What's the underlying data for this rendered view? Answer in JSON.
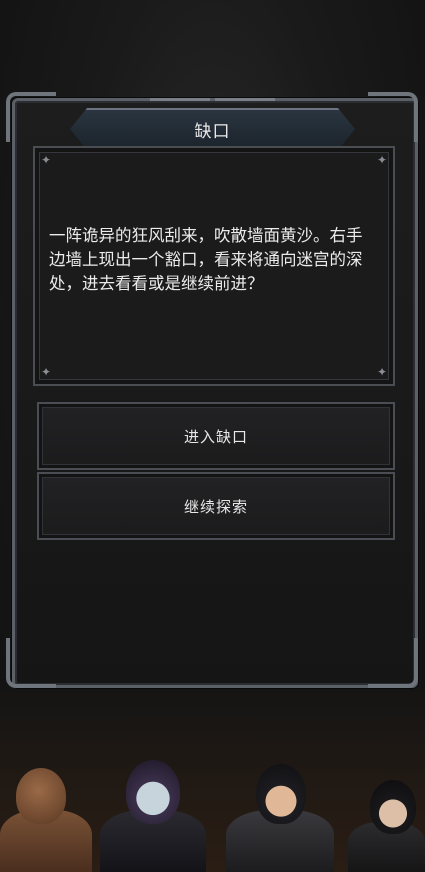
{
  "dialog": {
    "title": "缺口",
    "story": "一阵诡异的狂风刮来，吹散墙面黄沙。右手边墙上现出一个豁口，看来将通向迷宫的深处，进去看看或是继续前进？"
  },
  "choices": [
    {
      "label": "进入缺口"
    },
    {
      "label": "继续探索"
    }
  ],
  "party": [
    {
      "portrait": "brawler-portrait"
    },
    {
      "portrait": "hooded-mage-portrait"
    },
    {
      "portrait": "nun-warrior-portrait"
    },
    {
      "portrait": "nun-portrait"
    }
  ]
}
